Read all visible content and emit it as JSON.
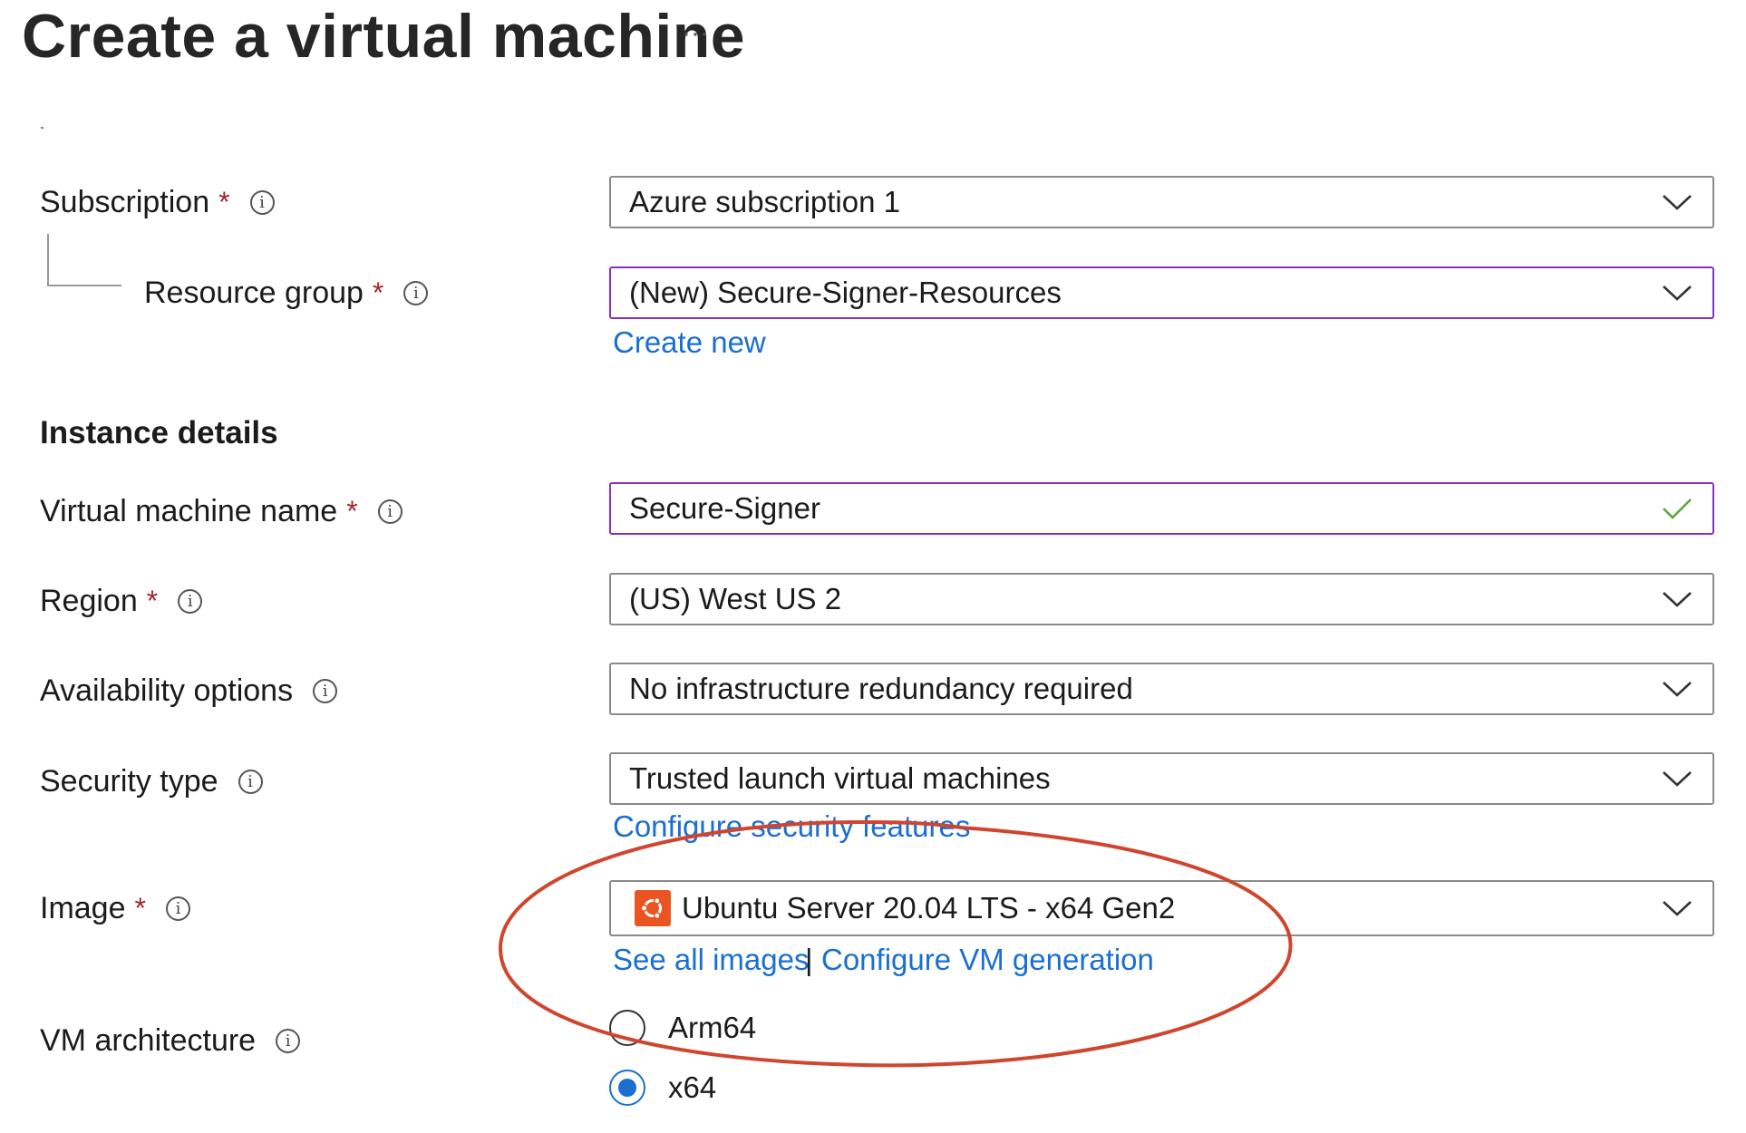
{
  "header": {
    "title": "Create a virtual machine",
    "more_label": "···"
  },
  "form": {
    "subscription": {
      "label": "Subscription",
      "required": "*",
      "value": "Azure subscription 1"
    },
    "resource_group": {
      "label": "Resource group",
      "required": "*",
      "value": "(New) Secure-Signer-Resources",
      "create_new": "Create new"
    },
    "instance_details": {
      "heading": "Instance details"
    },
    "vm_name": {
      "label": "Virtual machine name",
      "required": "*",
      "value": "Secure-Signer"
    },
    "region": {
      "label": "Region",
      "required": "*",
      "value": "(US) West US 2"
    },
    "availability": {
      "label": "Availability options",
      "value": "No infrastructure redundancy required"
    },
    "security_type": {
      "label": "Security type",
      "value": "Trusted launch virtual machines",
      "configure_link": "Configure security features"
    },
    "image": {
      "label": "Image",
      "required": "*",
      "value": "Ubuntu Server 20.04 LTS - x64 Gen2",
      "see_all_link": "See all images",
      "separator": "|",
      "configure_gen_link": "Configure VM generation"
    },
    "vm_architecture": {
      "label": "VM architecture",
      "options": [
        {
          "label": "Arm64",
          "selected": false
        },
        {
          "label": "x64",
          "selected": true
        }
      ]
    }
  },
  "icons": {
    "info": "info-icon",
    "dropdown": "chevron-down-icon",
    "valid": "checkmark-icon",
    "image_logo": "ubuntu-logo-icon"
  },
  "colors": {
    "link": "#1a6fd0",
    "required": "#a4262c",
    "focus_border": "#8a2fc4",
    "annotation": "#d0452e",
    "valid": "#5aa83c"
  }
}
